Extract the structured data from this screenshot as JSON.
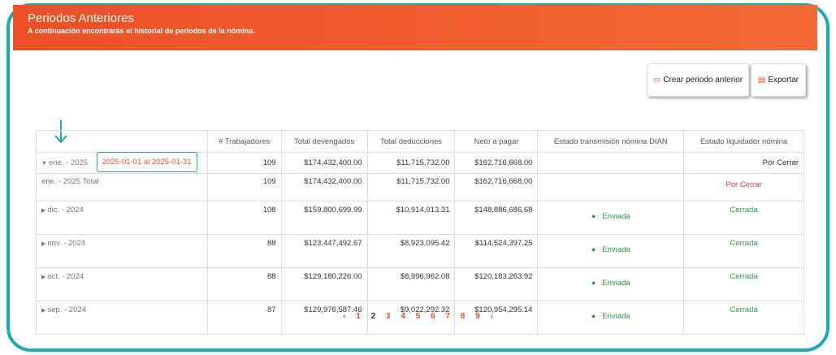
{
  "header": {
    "title": "Periodos Anteriores",
    "subtitle": "A continuación encontrarás el historial de periodos de la nómina."
  },
  "actions": {
    "create_label": "Crear periodo anterior",
    "export_label": "Exportar"
  },
  "table": {
    "columns": [
      "# Trabajadores",
      "Total devengados",
      "Total deducciones",
      "Neto a pagar",
      "Estado transmisión nómina DIAN",
      "Estado liquidador nómina"
    ],
    "rows": [
      {
        "period": "ene. - 2025",
        "range": "2025-01-01 al 2025-01-31",
        "workers": "109",
        "devengados": "$174,432,400.00",
        "deducciones": "$11,715,732.00",
        "neto": "$162,716,668.00",
        "dian": "",
        "liquidador": "Por Cerrar"
      },
      {
        "period": "ene. - 2025 Total",
        "workers": "109",
        "devengados": "$174,432,400.00",
        "deducciones": "$11,715,732.00",
        "neto": "$162,716,668.00",
        "dian": "",
        "liquidador": "Por Cerrar"
      },
      {
        "period": "dic. - 2024",
        "workers": "108",
        "devengados": "$159,800,699.99",
        "deducciones": "$10,914,013.31",
        "neto": "$148,886,686.68",
        "dian": "Enviada",
        "liquidador": "Cerrada"
      },
      {
        "period": "nov. - 2024",
        "workers": "88",
        "devengados": "$123,447,492.67",
        "deducciones": "$8,923,095.42",
        "neto": "$114,524,397.25",
        "dian": "Enviada",
        "liquidador": "Cerrada"
      },
      {
        "period": "oct. - 2024",
        "workers": "88",
        "devengados": "$129,180,226.00",
        "deducciones": "$8,996,962.08",
        "neto": "$120,183,263.92",
        "dian": "Enviada",
        "liquidador": "Cerrada"
      },
      {
        "period": "sep. - 2024",
        "workers": "87",
        "devengados": "$129,976,587.46",
        "deducciones": "$9,022,292.32",
        "neto": "$120,954,295.14",
        "dian": "Enviada",
        "liquidador": "Cerrada"
      }
    ]
  },
  "pagination": {
    "prev": "‹",
    "pages": [
      "1",
      "2",
      "3",
      "4",
      "5",
      "6",
      "7",
      "8",
      "9"
    ],
    "current": "2",
    "next": "›"
  },
  "colors": {
    "header": "#f05a2c",
    "accent": "#e8502a",
    "frame": "#1ba9b4",
    "success": "#2a9a3a",
    "danger": "#e03a3a"
  }
}
